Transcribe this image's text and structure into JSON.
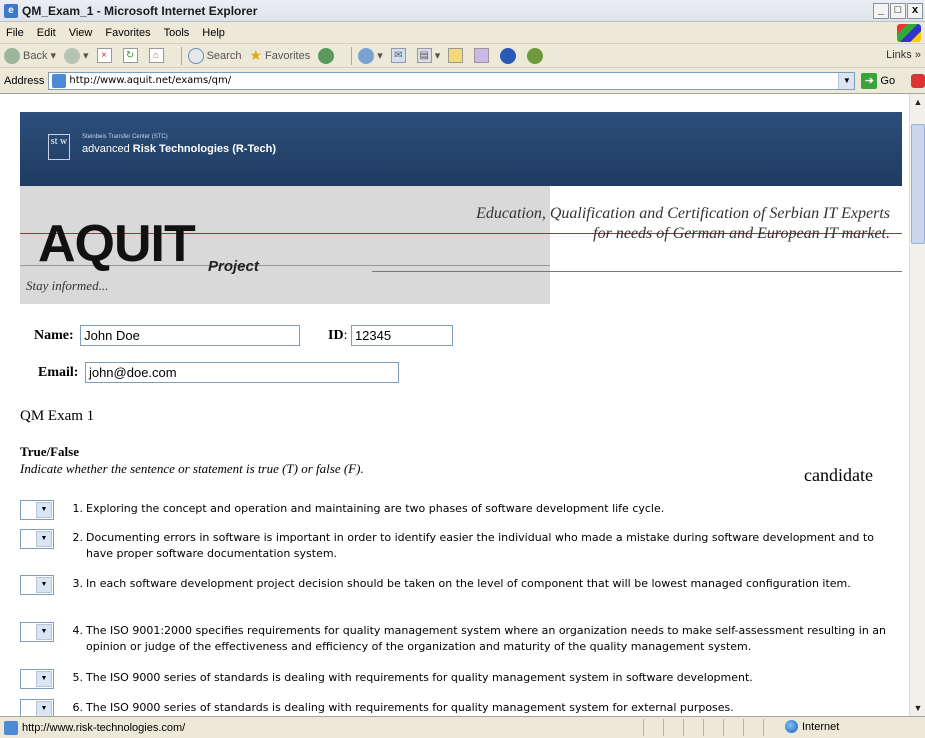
{
  "window": {
    "title": "QM_Exam_1 - Microsoft Internet Explorer",
    "controls": [
      "_",
      "□",
      "x"
    ]
  },
  "menu": [
    "File",
    "Edit",
    "View",
    "Favorites",
    "Tools",
    "Help"
  ],
  "toolbar": {
    "back": "Back",
    "search": "Search",
    "favorites": "Favorites",
    "links": "Links"
  },
  "address": {
    "label": "Address",
    "url": "http://www.aquit.net/exams/qm/",
    "go": "Go"
  },
  "banner": {
    "stc_small": "Steinbeis Transfer Center (STC)",
    "rtech_prefix": "advanced ",
    "rtech_bold": "Risk Technologies (R-Tech)",
    "logo_text": "st w"
  },
  "hero": {
    "tagline_line1": "Education, Qualification and Certification of Serbian IT Experts",
    "tagline_line2": "for needs of German and European IT market.",
    "brand": "AQUIT",
    "brand_sub": "Project",
    "stay": "Stay informed..."
  },
  "form": {
    "name_label": "Name",
    "name_value": "John Doe",
    "id_label": "ID",
    "id_value": "12345",
    "email_label": "Email",
    "email_value": "john@doe.com"
  },
  "exam": {
    "title": "QM Exam 1",
    "section_title": "True/False",
    "section_instructions": "Indicate whether the sentence or statement is true (T) or false (F).",
    "side_text": "candidate",
    "questions": [
      {
        "num": "1.",
        "text": "Exploring the concept and operation and maintaining are two phases of software development life cycle."
      },
      {
        "num": "2.",
        "text": "Documenting errors in software is important in order to identify easier the individual who made a mistake during software development and to have proper software documentation system."
      },
      {
        "num": "3.",
        "text": "In each software development project decision should be taken on the level of component that will be lowest managed configuration item."
      },
      {
        "num": "4.",
        "text": "The ISO 9001:2000 specifies requirements for quality management system where an organization needs to make self-assessment resulting in an opinion or judge of the effectiveness and efficiency of the organization and maturity of the quality management system."
      },
      {
        "num": "5.",
        "text": "The ISO 9000 series of standards is dealing with requirements for quality management system in software development."
      },
      {
        "num": "6.",
        "text": "The ISO 9000 series of standards is dealing with requirements for quality management system for external purposes."
      }
    ]
  },
  "status": {
    "text": "http://www.risk-technologies.com/",
    "zone": "Internet"
  }
}
